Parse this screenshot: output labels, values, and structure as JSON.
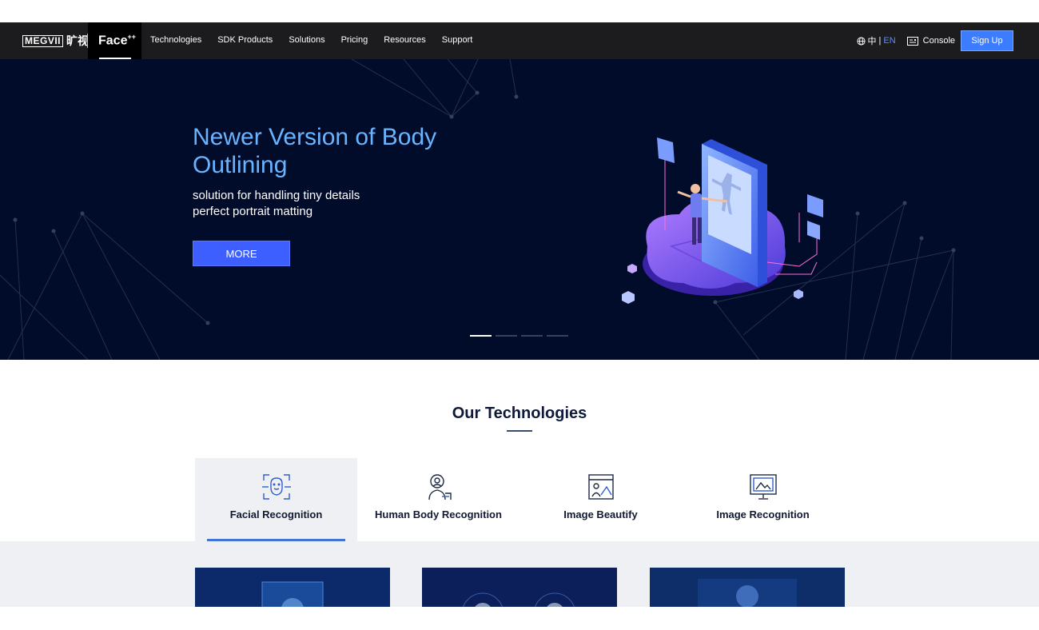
{
  "header": {
    "brand_box": "MEGVII",
    "brand_cn": "旷视",
    "product": "Face",
    "product_sup": "++",
    "nav": [
      "Technologies",
      "SDK Products",
      "Solutions",
      "Pricing",
      "Resources",
      "Support"
    ],
    "lang_cn": "中",
    "lang_sep": "|",
    "lang_en": "EN",
    "console": "Console",
    "signup": "Sign Up"
  },
  "hero": {
    "title": "Newer Version of Body Outlining",
    "subtitle": "solution for handling tiny details\nperfect portrait matting",
    "button": "MORE",
    "active_slide": 1,
    "slide_count": 4
  },
  "technologies": {
    "title": "Our Technologies",
    "tabs": [
      {
        "label": "Facial Recognition",
        "icon": "face-scan-icon",
        "active": true
      },
      {
        "label": "Human Body Recognition",
        "icon": "body-scan-icon",
        "active": false
      },
      {
        "label": "Image Beautify",
        "icon": "image-beautify-icon",
        "active": false
      },
      {
        "label": "Image Recognition",
        "icon": "image-recognition-icon",
        "active": false
      }
    ]
  },
  "colors": {
    "header_bg": "#1c1c1e",
    "hero_bg": "#000c2a",
    "hero_title": "#6ab4ff",
    "accent": "#3d5fff",
    "signup": "#3c7cff",
    "tab_active_bar": "#3f74d8"
  }
}
